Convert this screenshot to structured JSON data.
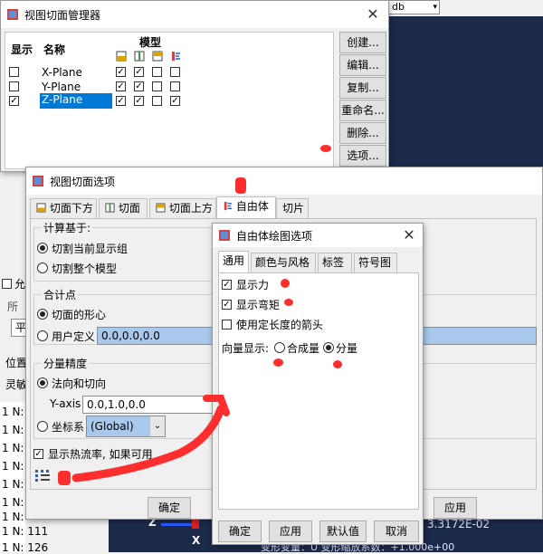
{
  "colors": {
    "viewport": "#1c2a4a",
    "selection": "#0078d7",
    "field_blue": "#a8c8ec",
    "scribble": "#ff2e2e"
  },
  "background": {
    "dropdown_value": "db",
    "left_label_1": "允",
    "left_label_2": "所",
    "left_label_3": "平",
    "left_label_4": "位置",
    "left_label_5": "灵敏",
    "log_rows": [
      "1 N:",
      "1 N:",
      "1 N:",
      "1 N:",
      "1 N:",
      "1 N:",
      "1 N:",
      "1 N: 111",
      "1 N: 126"
    ],
    "viewport_value": "3.3172E-02",
    "viewport_footer": "变形变量：U   变形缩放系数：+1.000e+00",
    "axis_z": "Z",
    "axis_x": "X"
  },
  "manager": {
    "title": "视图切面管理器",
    "col_show": "显示",
    "col_name": "名称",
    "col_model": "模型",
    "rows": [
      {
        "name": "X-Plane",
        "show": false,
        "flags": [
          true,
          true,
          false,
          false
        ],
        "selected": false
      },
      {
        "name": "Y-Plane",
        "show": false,
        "flags": [
          true,
          true,
          false,
          false
        ],
        "selected": false
      },
      {
        "name": "Z-Plane",
        "show": true,
        "flags": [
          true,
          true,
          false,
          true
        ],
        "selected": true
      }
    ],
    "buttons": [
      "创建...",
      "编辑...",
      "复制...",
      "重命名...",
      "删除...",
      "选项..."
    ]
  },
  "options": {
    "title": "视图切面选项",
    "tabs": [
      "切面下方",
      "切面",
      "切面上方",
      "自由体",
      "切片"
    ],
    "active_tab": 3,
    "calc_group": "计算基于:",
    "calc_opt1": "切割当前显示组",
    "calc_opt2": "切割整个模型",
    "sum_group": "合计点",
    "sum_opt1": "切面的形心",
    "sum_opt2": "用户定义",
    "sum_value": "0.0,0.0,0.0",
    "prec_group": "分量精度",
    "prec_opt1": "法向和切向",
    "yaxis_label": "Y-axis",
    "yaxis_value": "0.0,1.0,0.0",
    "csys_label": "坐标系",
    "csys_value": "(Global)",
    "heat_flux": "显示热流率, 如果可用",
    "ok": "确定",
    "apply": "应用"
  },
  "fb": {
    "title": "自由体绘图选项",
    "tabs": [
      "通用",
      "颜色与风格",
      "标签",
      "符号图"
    ],
    "show_force": "显示力",
    "show_moment": "显示弯矩",
    "fixed_arrow": "使用定长度的箭头",
    "vector_label": "向量显示:",
    "vector_opt1": "合成量",
    "vector_opt2": "分量",
    "ok": "确定",
    "apply": "应用",
    "defaults": "默认值",
    "cancel": "取消"
  }
}
